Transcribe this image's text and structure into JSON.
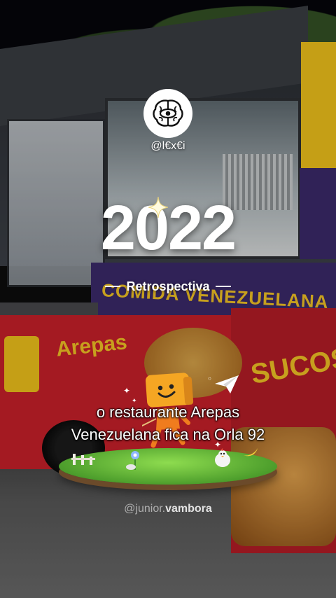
{
  "profile": {
    "username": "@l€x€i",
    "avatar_icon": "brain-eye-icon"
  },
  "title": {
    "year": "2022",
    "subtitle": "Retrospectiva"
  },
  "background_sign": {
    "banner": "COMIDA VENEZUELANA",
    "left_sign": "Arepas",
    "right_sign": "SUCOS"
  },
  "caption": {
    "line1": "o restaurante Arepas",
    "line2": "Venezuelana fica na Orla 92"
  },
  "credit": {
    "prefix": "@junior.",
    "name": "vambora"
  },
  "colors": {
    "accent_yellow": "#f3c425",
    "truck_red": "#c8202a",
    "truck_purple": "#3b2a6b",
    "mascot_orange": "#f5a623"
  }
}
